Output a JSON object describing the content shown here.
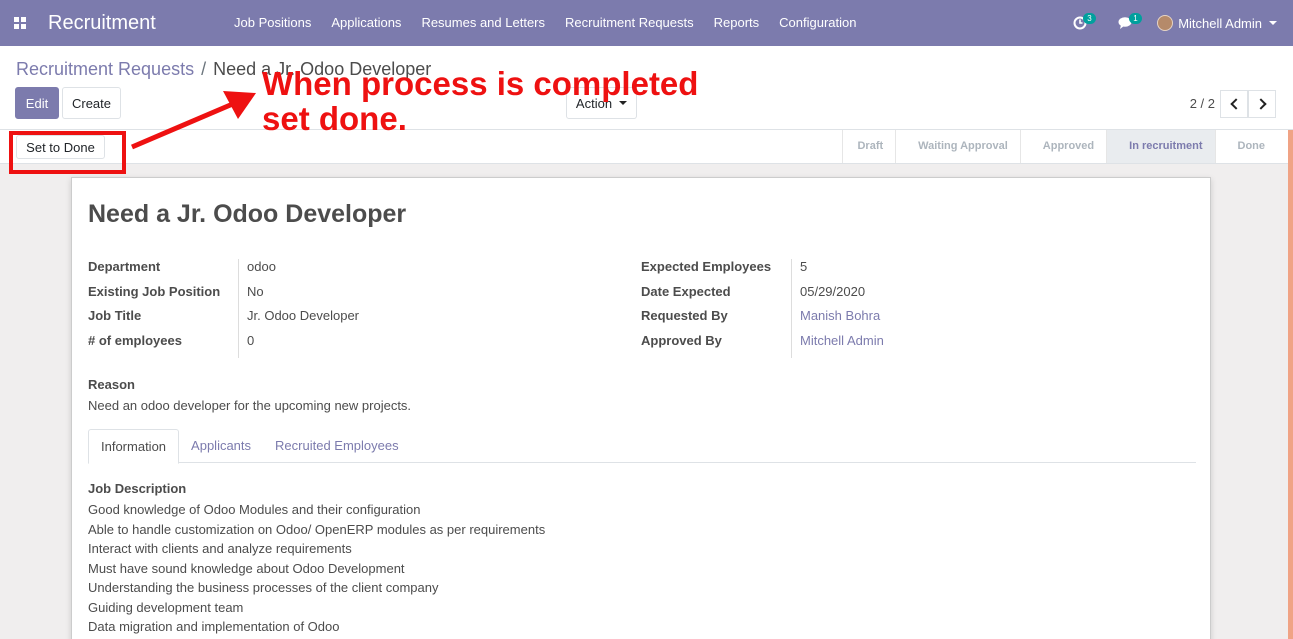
{
  "navbar": {
    "brand": "Recruitment",
    "menu": [
      "Job Positions",
      "Applications",
      "Resumes and Letters",
      "Recruitment Requests",
      "Reports",
      "Configuration"
    ],
    "activity_count": "3",
    "message_count": "1",
    "user_name": "Mitchell Admin"
  },
  "breadcrumb": {
    "parent": "Recruitment Requests",
    "separator": "/",
    "current": "Need a Jr. Odoo Developer"
  },
  "buttons": {
    "edit": "Edit",
    "create": "Create",
    "action": "Action",
    "set_to_done": "Set to Done"
  },
  "pager": {
    "value": "2 / 2"
  },
  "stages": [
    "Draft",
    "Waiting Approval",
    "Approved",
    "In recruitment",
    "Done"
  ],
  "active_stage": "In recruitment",
  "record": {
    "title": "Need a Jr. Odoo Developer",
    "left_fields": [
      {
        "label": "Department",
        "value": "odoo"
      },
      {
        "label": "Existing Job Position",
        "value": "No"
      },
      {
        "label": "Job Title",
        "value": "Jr. Odoo Developer"
      },
      {
        "label": "# of employees",
        "value": "0"
      }
    ],
    "right_fields": [
      {
        "label": "Expected Employees",
        "value": "5"
      },
      {
        "label": "Date Expected",
        "value": "05/29/2020"
      },
      {
        "label": "Requested By",
        "value": "Manish Bohra"
      },
      {
        "label": "Approved By",
        "value": "Mitchell Admin"
      }
    ],
    "reason_label": "Reason",
    "reason": "Need an odoo developer for the upcoming new projects."
  },
  "tabs": [
    "Information",
    "Applicants",
    "Recruited Employees"
  ],
  "job_description": {
    "label": "Job Description",
    "lines": [
      "Good knowledge of Odoo Modules and their configuration",
      "Able to handle customization on Odoo/ OpenERP modules as per requirements",
      "Interact with clients and analyze requirements",
      "Must have sound knowledge about Odoo Development",
      "Understanding the business processes of the client company",
      "Guiding development team",
      "Data migration and implementation of Odoo"
    ]
  },
  "annotation": {
    "line1": "When process is completed",
    "line2": "set done."
  },
  "colors": {
    "brand": "#7c7bad",
    "annotation": "#ee1111"
  }
}
